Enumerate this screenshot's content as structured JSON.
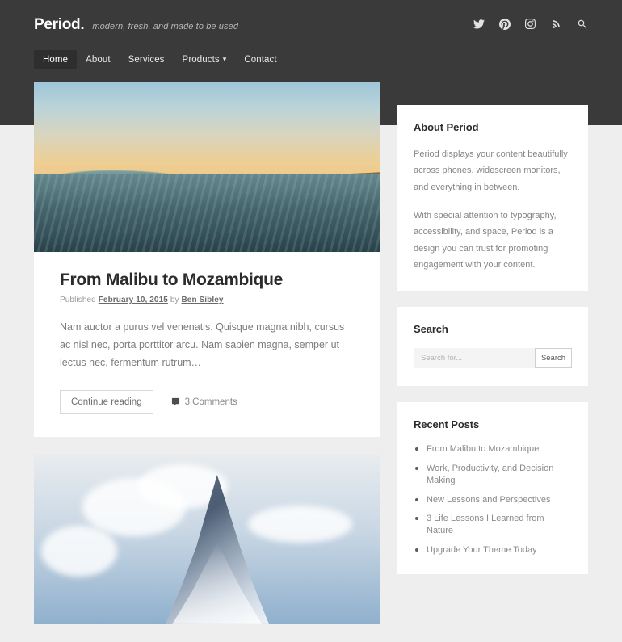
{
  "site": {
    "logo": "Period.",
    "tagline": "modern, fresh, and made to be used"
  },
  "header": {
    "nav": [
      {
        "label": "Home",
        "active": true,
        "has_dropdown": false
      },
      {
        "label": "About",
        "active": false,
        "has_dropdown": false
      },
      {
        "label": "Services",
        "active": false,
        "has_dropdown": false
      },
      {
        "label": "Products",
        "active": false,
        "has_dropdown": true
      },
      {
        "label": "Contact",
        "active": false,
        "has_dropdown": false
      }
    ],
    "social": [
      {
        "name": "twitter-icon"
      },
      {
        "name": "pinterest-icon"
      },
      {
        "name": "instagram-icon"
      },
      {
        "name": "rss-icon"
      },
      {
        "name": "search-icon"
      }
    ]
  },
  "posts": [
    {
      "title": "From Malibu to Mozambique",
      "published_label": "Published",
      "date": "February 10, 2015",
      "by_label": "by",
      "author": "Ben Sibley",
      "excerpt": "Nam auctor a purus vel venenatis. Quisque magna nibh, cursus ac nisl nec, porta porttitor arcu. Nam sapien magna, semper ut lectus nec, fermentum rutrum…",
      "continue_label": "Continue reading",
      "comments_label": "3 Comments",
      "image_alt": "ocean-wave-sunset-coastline"
    },
    {
      "image_alt": "snow-covered-mountain-peak"
    }
  ],
  "sidebar": {
    "about": {
      "title": "About Period",
      "paragraph1": "Period displays your content beautifully across phones, widescreen monitors, and everything in between.",
      "paragraph2": "With special attention to typography, accessibility, and space, Period is a design you can trust for promoting engagement with your content."
    },
    "search": {
      "title": "Search",
      "placeholder": "Search for...",
      "value": "",
      "button_label": "Search"
    },
    "recent": {
      "title": "Recent Posts",
      "items": [
        "From Malibu to Mozambique",
        "Work, Productivity, and Decision Making",
        "New Lessons and Perspectives",
        "3 Life Lessons I Learned from Nature",
        "Upgrade Your Theme Today"
      ]
    }
  },
  "colors": {
    "header_bg": "#3a3a3a",
    "nav_active_bg": "#2e2e2e",
    "page_bg": "#eeeeee",
    "card_bg": "#ffffff",
    "body_text": "#7c7c7c",
    "heading_text": "#2b2b2b"
  }
}
